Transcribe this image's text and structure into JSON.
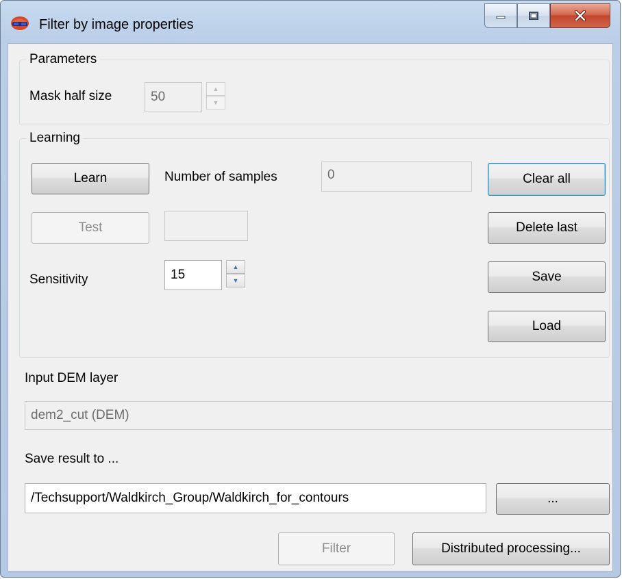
{
  "window": {
    "title": "Filter by image properties"
  },
  "parameters": {
    "group_title": "Parameters",
    "mask_half_size_label": "Mask half size",
    "mask_half_size_value": "50"
  },
  "learning": {
    "group_title": "Learning",
    "learn_label": "Learn",
    "samples_label": "Number of samples",
    "samples_value": "0",
    "clear_all_label": "Clear all",
    "test_label": "Test",
    "test_value": "",
    "delete_last_label": "Delete last",
    "sensitivity_label": "Sensitivity",
    "sensitivity_value": "15",
    "save_label": "Save",
    "load_label": "Load"
  },
  "input": {
    "label": "Input DEM layer",
    "value": "dem2_cut (DEM)"
  },
  "output": {
    "label": "Save result to ...",
    "path": "/Techsupport/Waldkirch_Group/Waldkirch_for_contours",
    "browse_label": "..."
  },
  "footer": {
    "filter_label": "Filter",
    "distributed_label": "Distributed processing..."
  }
}
